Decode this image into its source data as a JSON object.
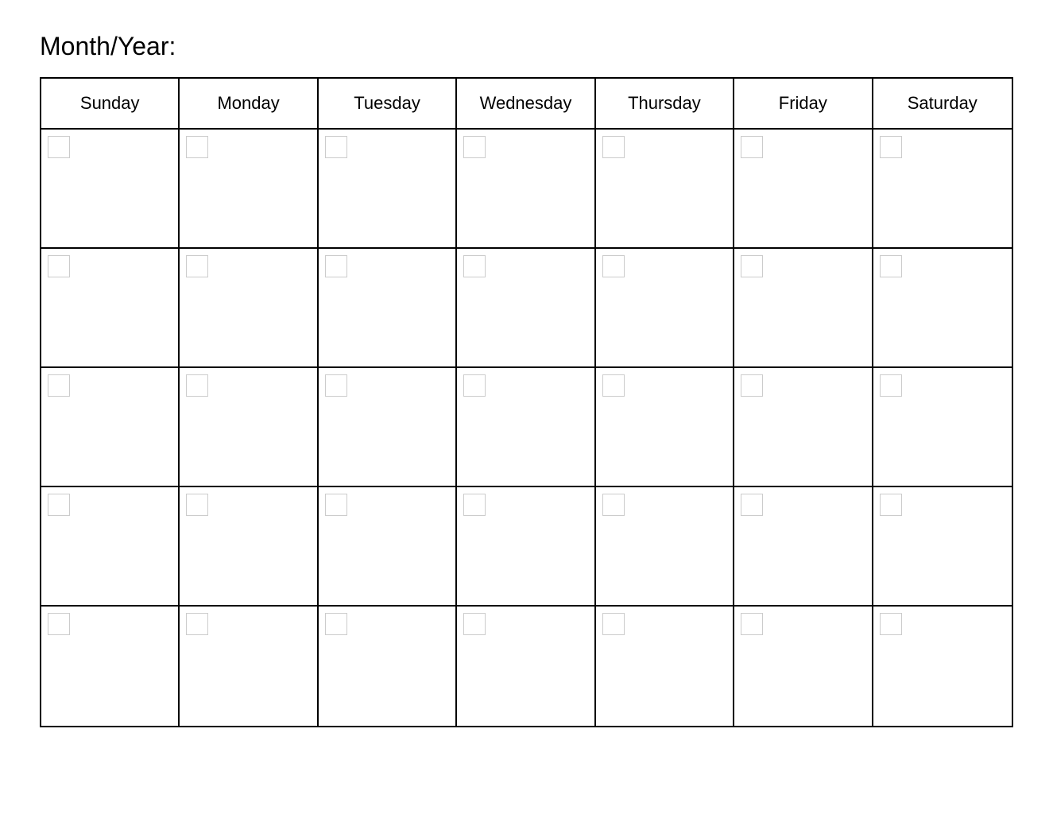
{
  "header": {
    "month_year_label": "Month/Year:"
  },
  "calendar": {
    "days_of_week": [
      "Sunday",
      "Monday",
      "Tuesday",
      "Wednesday",
      "Thursday",
      "Friday",
      "Saturday"
    ],
    "weeks": 5,
    "days_per_week": 7
  }
}
